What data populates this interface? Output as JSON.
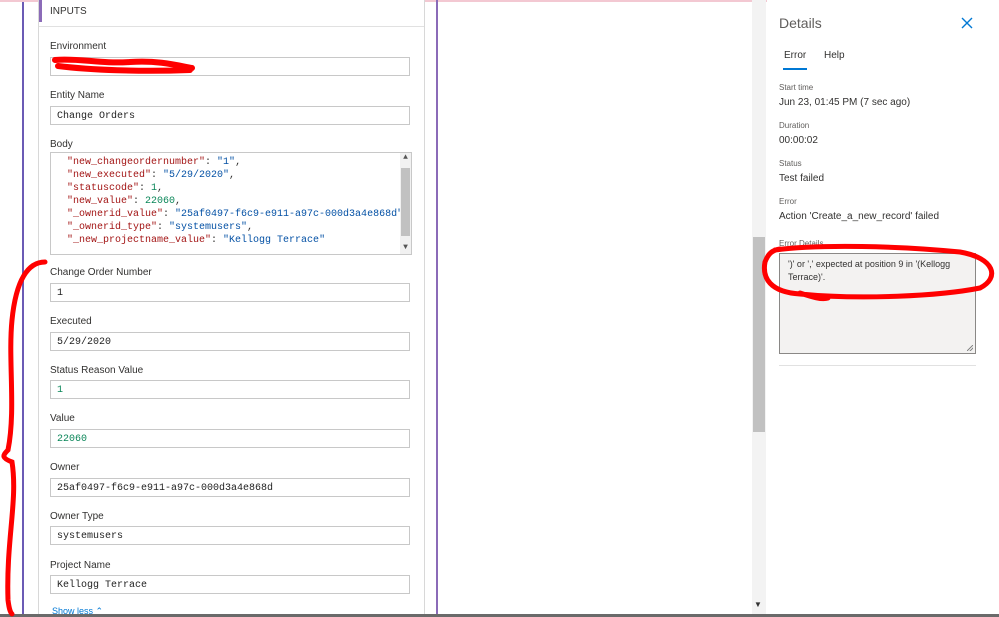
{
  "inputs": {
    "header": "INPUTS",
    "environment": {
      "label": "Environment",
      "value": ""
    },
    "entity_name": {
      "label": "Entity Name",
      "value": "Change Orders"
    },
    "body": {
      "label": "Body",
      "lines": [
        {
          "key": "\"new_changeordernumber\"",
          "value": "\"1\"",
          "value_type": "s",
          "trailing": ","
        },
        {
          "key": "\"new_executed\"",
          "value": "\"5/29/2020\"",
          "value_type": "s",
          "trailing": ","
        },
        {
          "key": "\"statuscode\"",
          "value": "1",
          "value_type": "n",
          "trailing": ","
        },
        {
          "key": "\"new_value\"",
          "value": "22060",
          "value_type": "n",
          "trailing": ","
        },
        {
          "key": "\"_ownerid_value\"",
          "value": "\"25af0497-f6c9-e911-a97c-000d3a4e868d\"",
          "value_type": "s",
          "trailing": ","
        },
        {
          "key": "\"_ownerid_type\"",
          "value": "\"systemusers\"",
          "value_type": "s",
          "trailing": ","
        },
        {
          "key": "\"_new_projectname_value\"",
          "value": "\"Kellogg Terrace\"",
          "value_type": "s",
          "trailing": ""
        }
      ]
    },
    "change_order_number": {
      "label": "Change Order Number",
      "value": "1"
    },
    "executed": {
      "label": "Executed",
      "value": "5/29/2020"
    },
    "status_reason_value": {
      "label": "Status Reason Value",
      "value": "1"
    },
    "value": {
      "label": "Value",
      "value": "22060"
    },
    "owner": {
      "label": "Owner",
      "value": "25af0497-f6c9-e911-a97c-000d3a4e868d"
    },
    "owner_type": {
      "label": "Owner Type",
      "value": "systemusers"
    },
    "project_name": {
      "label": "Project Name",
      "value": "Kellogg Terrace"
    },
    "show_less": "Show less"
  },
  "details": {
    "title": "Details",
    "tabs": [
      {
        "label": "Error",
        "active": true
      },
      {
        "label": "Help",
        "active": false
      }
    ],
    "start_time": {
      "label": "Start time",
      "value": "Jun 23, 01:45 PM (7 sec ago)"
    },
    "duration": {
      "label": "Duration",
      "value": "00:00:02"
    },
    "status": {
      "label": "Status",
      "value": "Test failed"
    },
    "error": {
      "label": "Error",
      "value": "Action 'Create_a_new_record' failed"
    },
    "error_details": {
      "label": "Error Details",
      "value": "')' or ',' expected at position 9 in '(Kellogg Terrace)'."
    }
  },
  "colors": {
    "accent": "#0078d4",
    "purple": "#8b6bb8",
    "annotation": "#ff0000"
  }
}
